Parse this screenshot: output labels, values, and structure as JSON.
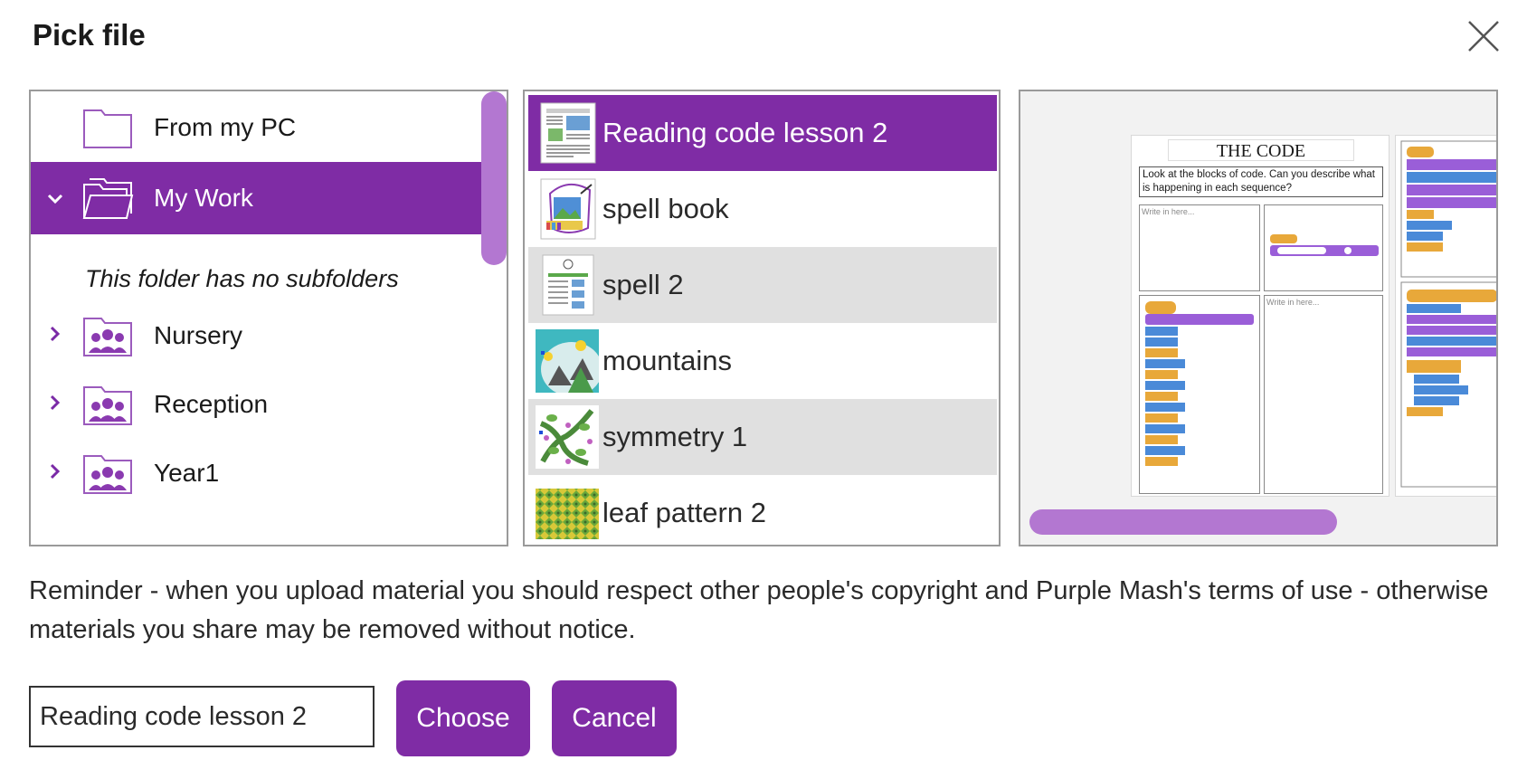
{
  "dialog": {
    "title": "Pick file",
    "close_icon": "close-icon"
  },
  "folders": {
    "items": [
      {
        "label": "From my PC",
        "icon": "folder-outline-icon",
        "expanded": false,
        "selected": false
      },
      {
        "label": "My Work",
        "icon": "folder-open-icon",
        "expanded": true,
        "selected": true
      },
      {
        "label": "Nursery",
        "icon": "class-folder-icon",
        "expanded": false,
        "selected": false
      },
      {
        "label": "Reception",
        "icon": "class-folder-icon",
        "expanded": false,
        "selected": false
      },
      {
        "label": "Year1",
        "icon": "class-folder-icon",
        "expanded": false,
        "selected": false
      }
    ],
    "no_subfolders_note": "This folder has no subfolders"
  },
  "files": {
    "items": [
      {
        "name": "Reading code lesson 2",
        "selected": true
      },
      {
        "name": "spell book",
        "selected": false
      },
      {
        "name": "spell 2",
        "selected": false
      },
      {
        "name": "mountains",
        "selected": false
      },
      {
        "name": "symmetry 1",
        "selected": false
      },
      {
        "name": "leaf pattern 2",
        "selected": false
      }
    ]
  },
  "preview": {
    "doc_title": "THE CODE",
    "doc_instruction": "Look at the blocks of code. Can you describe what is happening in each sequence?",
    "write_hint": "Write in here..."
  },
  "reminder": "Reminder - when you upload material you should respect other people's copyright and Purple Mash's terms of use - otherwise materials you share may be removed without notice.",
  "footer": {
    "filename_value": "Reading code lesson 2",
    "choose_label": "Choose",
    "cancel_label": "Cancel"
  },
  "colors": {
    "accent": "#7f2ca5",
    "scrollbar": "#b377d1",
    "row_alt": "#e0e0e0"
  }
}
